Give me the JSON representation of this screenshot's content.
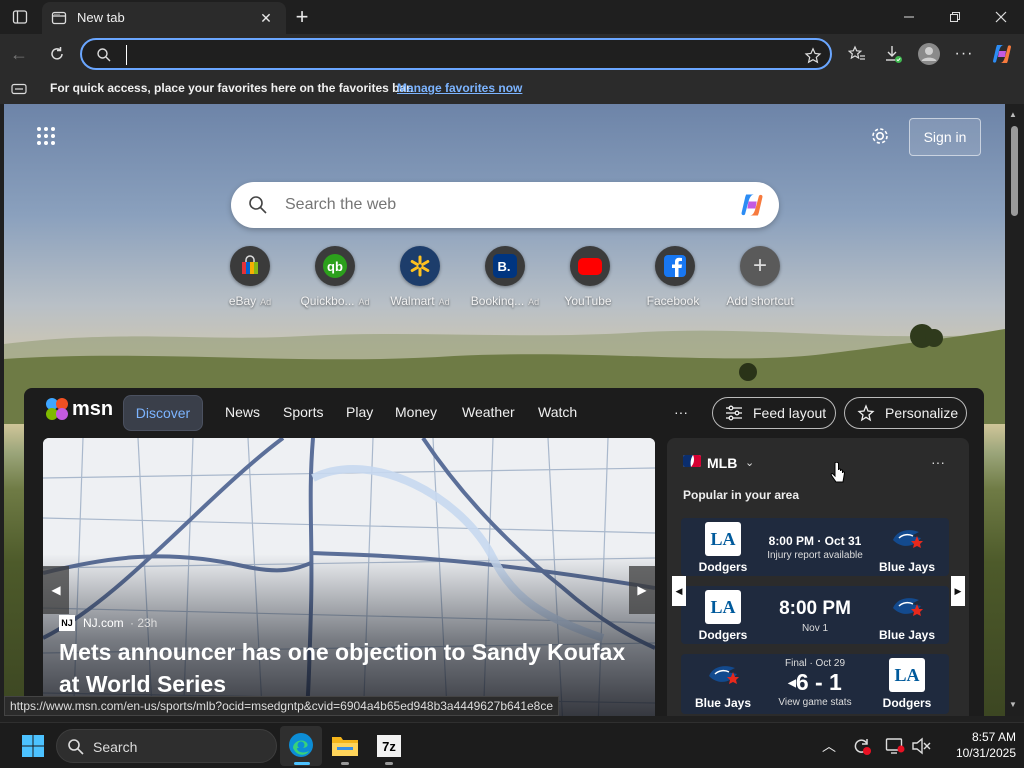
{
  "browser": {
    "tab_title": "New tab",
    "address_value": "",
    "favbar_text": "For quick access, place your favorites here on the favorites bar.",
    "favbar_link": "Manage favorites now"
  },
  "page": {
    "sign_in": "Sign in",
    "search_placeholder": "Search the web",
    "shortcuts": [
      {
        "label": "eBay",
        "ad": "Ad"
      },
      {
        "label": "Quickbo...",
        "ad": "Ad"
      },
      {
        "label": "Walmart",
        "ad": "Ad"
      },
      {
        "label": "Bookinq...",
        "ad": "Ad"
      },
      {
        "label": "YouTube",
        "ad": ""
      },
      {
        "label": "Facebook",
        "ad": ""
      },
      {
        "label": "Add shortcut",
        "ad": ""
      }
    ]
  },
  "msn": {
    "logo_text": "msn",
    "nav": [
      "Discover",
      "News",
      "Sports",
      "Play",
      "Money",
      "Weather",
      "Watch"
    ],
    "more": "···",
    "feed_layout": "Feed layout",
    "personalize": "Personalize"
  },
  "hero": {
    "source": "NJ.com",
    "age": "· 23h",
    "headline_line1": "Mets announcer has one objection to Sandy Koufax",
    "headline_line2": "at World Series"
  },
  "mlb": {
    "title": "MLB",
    "more": "···",
    "subtitle": "Popular in your area",
    "games": [
      {
        "left_team": "Dodgers",
        "right_team": "Blue Jays",
        "main": "8:00 PM · Oct 31",
        "sub": "Injury report available"
      },
      {
        "left_team": "Dodgers",
        "right_team": "Blue Jays",
        "main": "8:00 PM",
        "sub": "Nov 1"
      },
      {
        "left_team": "Blue Jays",
        "right_team": "Dodgers",
        "top": "Final · Oct 29",
        "main": "6 - 1",
        "sub": "View game stats"
      }
    ]
  },
  "status_url": "https://www.msn.com/en-us/sports/mlb?ocid=msedgntp&cvid=6904a4b65ed948b3a4449627b641e8ce",
  "taskbar": {
    "search": "Search",
    "time": "8:57 AM",
    "date": "10/31/2025"
  }
}
